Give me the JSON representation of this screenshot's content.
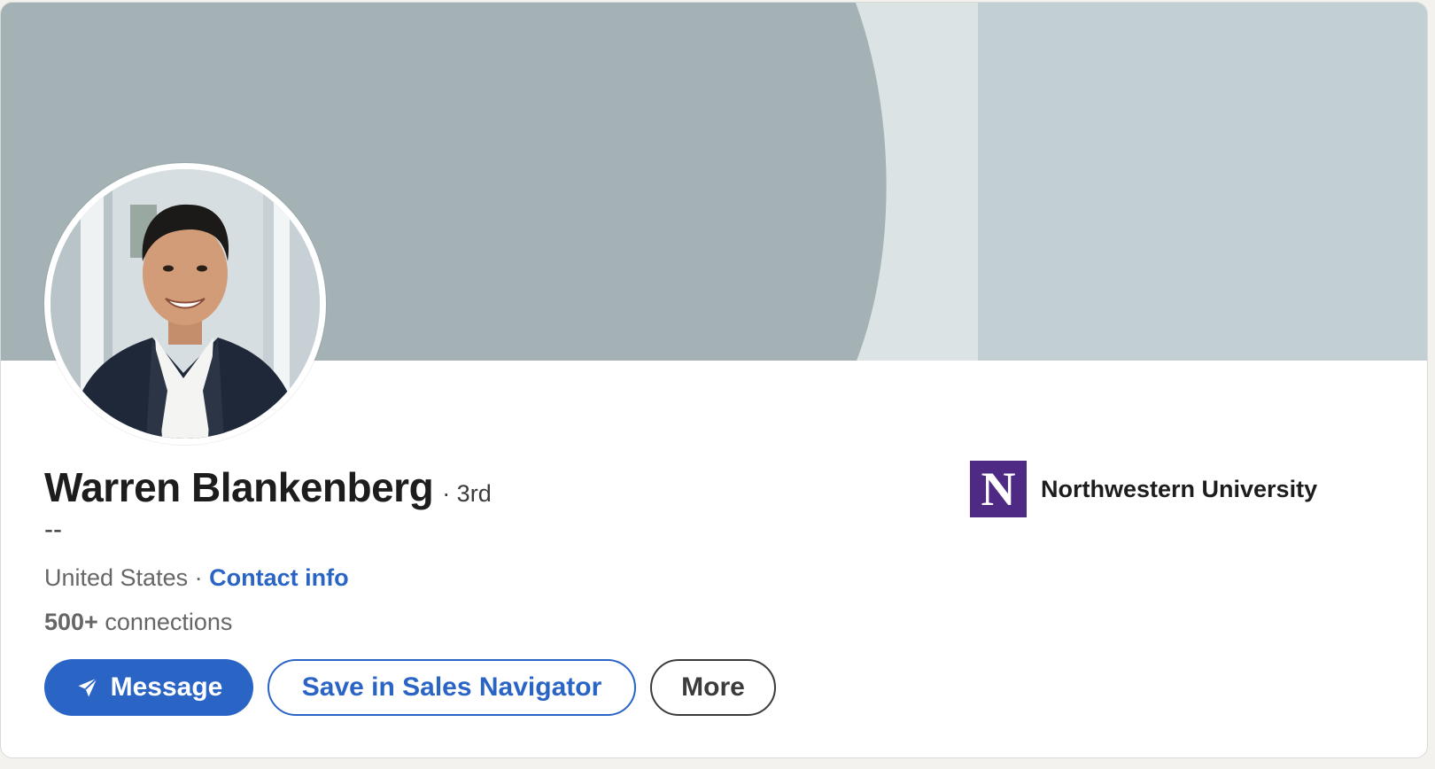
{
  "profile": {
    "name": "Warren Blankenberg",
    "degree": "· 3rd",
    "headline": "--",
    "location": "United States",
    "location_separator": " · ",
    "contact_info_label": "Contact info",
    "connections_count": "500+",
    "connections_label": " connections"
  },
  "actions": {
    "message_label": "Message",
    "save_label": "Save in Sales Navigator",
    "more_label": "More"
  },
  "education": {
    "logo_letter": "N",
    "school_name": "Northwestern University"
  },
  "colors": {
    "primary_blue": "#2a64c5",
    "school_purple": "#4e2a84",
    "banner_dark": "#a4b2b5",
    "banner_light": "#c2d0d3",
    "banner_strip": "#dbe3e5"
  },
  "icons": {
    "message": "paper-plane-icon",
    "school_logo": "northwestern-logo-icon"
  }
}
